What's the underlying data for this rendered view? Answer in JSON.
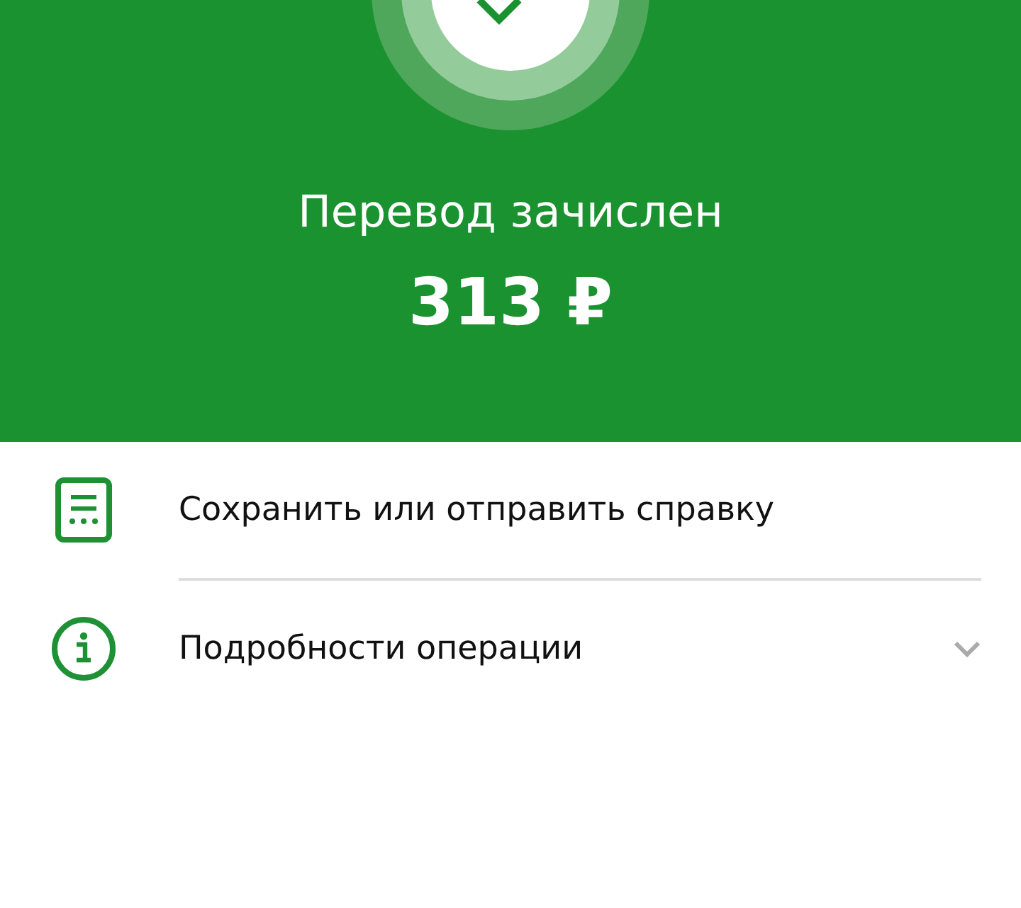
{
  "status": {
    "title": "Перевод зачислен",
    "amount": "313 ₽"
  },
  "actions": [
    {
      "kind": "document",
      "label": "Сохранить или отправить справку"
    },
    {
      "kind": "info",
      "label": "Подробности операции",
      "expanded": false
    }
  ]
}
